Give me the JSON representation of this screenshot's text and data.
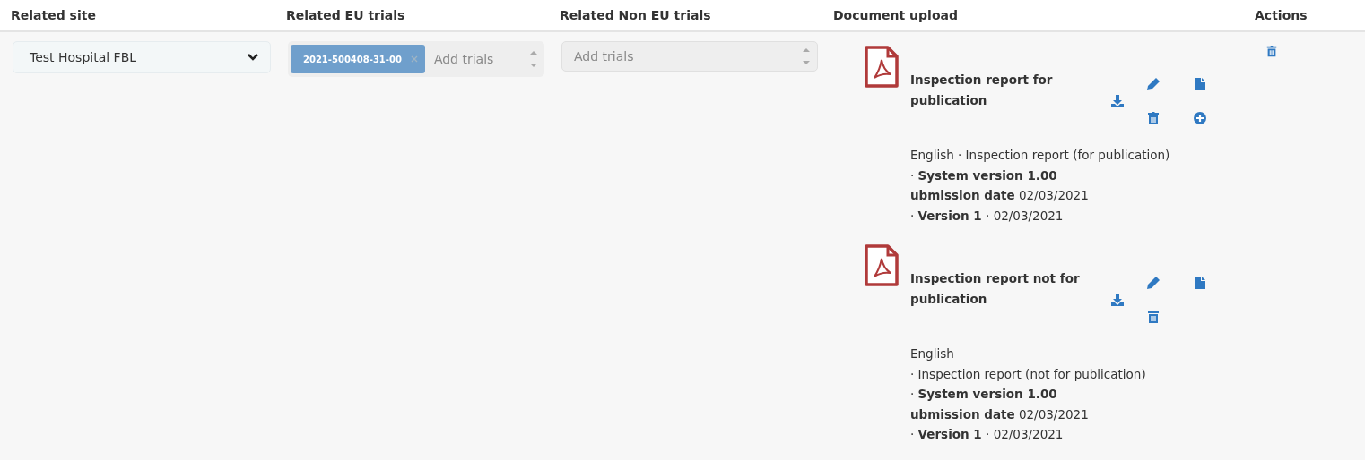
{
  "columns": [
    "Related site",
    "Related EU trials",
    "Related Non EU trials",
    "Document upload",
    "Actions"
  ],
  "row": {
    "site": {
      "value": "Test Hospital FBL"
    },
    "eu_trials": {
      "tags": [
        "2021-500408-31-00"
      ],
      "placeholder": "Add trials",
      "disabled": false
    },
    "non_eu_trials": {
      "placeholder": "Add trials",
      "disabled": true
    },
    "documents": [
      {
        "title": "Inspection report for publication",
        "actions": [
          {
            "kind": "edit"
          },
          {
            "kind": "file"
          },
          {
            "kind": "delete"
          },
          {
            "kind": "add"
          }
        ],
        "meta": [
          "English · Inspection report (for publication)",
          "· **System version 1.00**",
          "**ubmission date** 02/03/2021",
          "· **Version 1** · 02/03/2021"
        ]
      },
      {
        "title": "Inspection report not for publication",
        "actions": [
          {
            "kind": "edit"
          },
          {
            "kind": "file"
          },
          {
            "kind": "delete"
          }
        ],
        "meta": [
          "English",
          "· Inspection report (not for publication)",
          "· **System version 1.00**",
          "**ubmission date** 02/03/2021",
          "· **Version 1** · 02/03/2021"
        ]
      }
    ]
  }
}
